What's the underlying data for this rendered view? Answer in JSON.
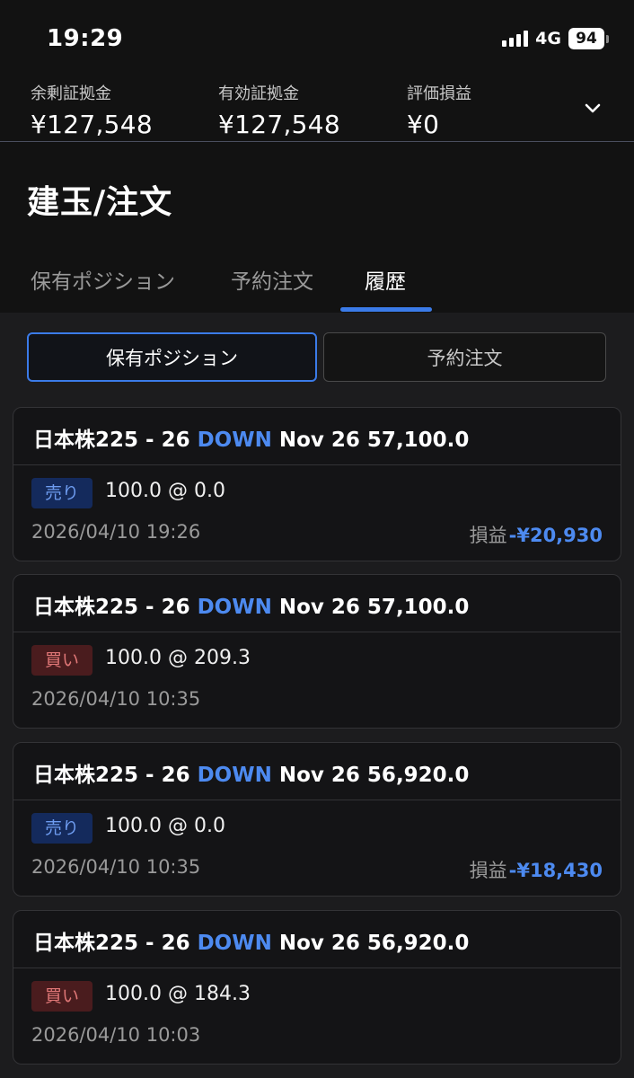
{
  "status": {
    "time": "19:29",
    "network": "4G",
    "battery": "94"
  },
  "summary": {
    "items": [
      {
        "label": "余剰証拠金",
        "value": "¥127,548"
      },
      {
        "label": "有効証拠金",
        "value": "¥127,548"
      },
      {
        "label": "評価損益",
        "value": "¥0"
      }
    ]
  },
  "page": {
    "title": "建玉/注文"
  },
  "tabs": [
    {
      "label": "保有ポジション",
      "active": false
    },
    {
      "label": "予約注文",
      "active": false
    },
    {
      "label": "履歴",
      "active": true
    }
  ],
  "segments": [
    {
      "label": "保有ポジション",
      "active": true
    },
    {
      "label": "予約注文",
      "active": false
    }
  ],
  "history": [
    {
      "instrument": "日本株225 - 26 ",
      "direction": "DOWN",
      "detail": " Nov 26 57,100.0",
      "side": "売り",
      "side_type": "sell",
      "qty": "100.0 @ 0.0",
      "datetime": "2026/04/10 19:26",
      "pnl_label": "損益",
      "pnl_value": "-¥20,930"
    },
    {
      "instrument": "日本株225 - 26 ",
      "direction": "DOWN",
      "detail": " Nov 26 57,100.0",
      "side": "買い",
      "side_type": "buy",
      "qty": "100.0 @ 209.3",
      "datetime": "2026/04/10 10:35",
      "pnl_label": "",
      "pnl_value": ""
    },
    {
      "instrument": "日本株225 - 26 ",
      "direction": "DOWN",
      "detail": " Nov 26 56,920.0",
      "side": "売り",
      "side_type": "sell",
      "qty": "100.0 @ 0.0",
      "datetime": "2026/04/10 10:35",
      "pnl_label": "損益",
      "pnl_value": "-¥18,430"
    },
    {
      "instrument": "日本株225 - 26 ",
      "direction": "DOWN",
      "detail": " Nov 26 56,920.0",
      "side": "買い",
      "side_type": "buy",
      "qty": "100.0 @ 184.3",
      "datetime": "2026/04/10 10:03",
      "pnl_label": "",
      "pnl_value": ""
    }
  ],
  "colors": {
    "accent": "#3b7be8",
    "sell_badge": "#142a5c",
    "buy_badge": "#4a1c1e",
    "pnl": "#4d8af0"
  },
  "icons": {
    "summary_expand": "chevron-down-icon",
    "signal": "cellular-signal-icon",
    "battery": "battery-icon"
  }
}
